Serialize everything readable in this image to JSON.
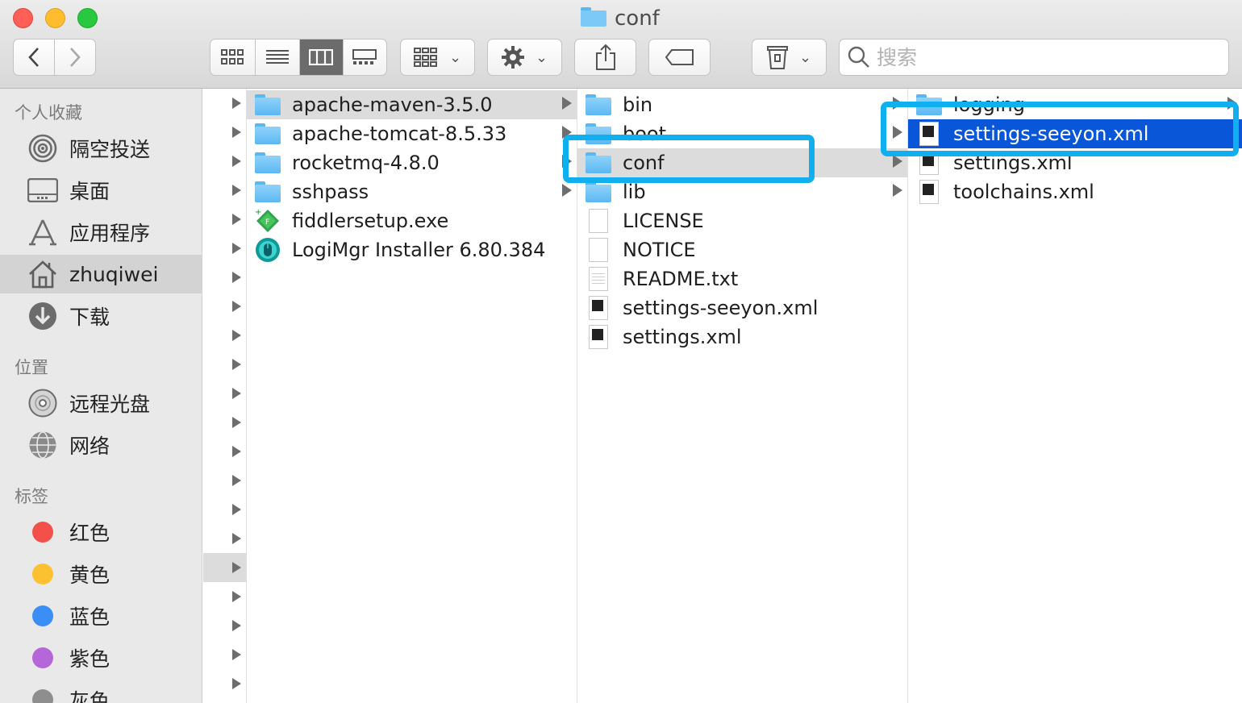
{
  "window": {
    "title": "conf"
  },
  "toolbar": {
    "back_label": "<",
    "forward_label": ">",
    "search_placeholder": "搜索"
  },
  "sidebar": {
    "favorites_heading": "个人收藏",
    "favorites": [
      {
        "label": "隔空投送",
        "icon": "airdrop-icon"
      },
      {
        "label": "桌面",
        "icon": "desktop-icon"
      },
      {
        "label": "应用程序",
        "icon": "applications-icon"
      },
      {
        "label": "zhuqiwei",
        "icon": "home-icon"
      },
      {
        "label": "下载",
        "icon": "download-icon"
      }
    ],
    "locations_heading": "位置",
    "locations": [
      {
        "label": "远程光盘",
        "icon": "disc-icon"
      },
      {
        "label": "网络",
        "icon": "network-icon"
      }
    ],
    "tags_heading": "标签",
    "tags": [
      {
        "label": "红色",
        "color": "#f4504a"
      },
      {
        "label": "黄色",
        "color": "#fcc130"
      },
      {
        "label": "蓝色",
        "color": "#3b8ef5"
      },
      {
        "label": "紫色",
        "color": "#b566d8"
      },
      {
        "label": "灰色",
        "color": "#8e8e8e"
      }
    ]
  },
  "column1": [
    {
      "label": "apache-maven-3.5.0",
      "type": "folder"
    },
    {
      "label": "apache-tomcat-8.5.33",
      "type": "folder"
    },
    {
      "label": "rocketmq-4.8.0",
      "type": "folder"
    },
    {
      "label": "sshpass",
      "type": "folder"
    },
    {
      "label": "fiddlersetup.exe",
      "type": "fiddler"
    },
    {
      "label": "LogiMgr Installer 6.80.384",
      "type": "logi"
    }
  ],
  "column2": [
    {
      "label": "bin",
      "type": "folder"
    },
    {
      "label": "boot",
      "type": "folder"
    },
    {
      "label": "conf",
      "type": "folder"
    },
    {
      "label": "lib",
      "type": "folder"
    },
    {
      "label": "LICENSE",
      "type": "doc"
    },
    {
      "label": "NOTICE",
      "type": "doc"
    },
    {
      "label": "README.txt",
      "type": "txt"
    },
    {
      "label": "settings-seeyon.xml",
      "type": "xml"
    },
    {
      "label": "settings.xml",
      "type": "xml"
    }
  ],
  "column3": [
    {
      "label": "logging",
      "type": "folder"
    },
    {
      "label": "settings-seeyon.xml",
      "type": "xml"
    },
    {
      "label": "settings.xml",
      "type": "xml"
    },
    {
      "label": "toolchains.xml",
      "type": "xml"
    }
  ],
  "colors": {
    "highlight": "#10b0f0",
    "selection": "#0a56d8",
    "folder": "#5cb8f2"
  }
}
